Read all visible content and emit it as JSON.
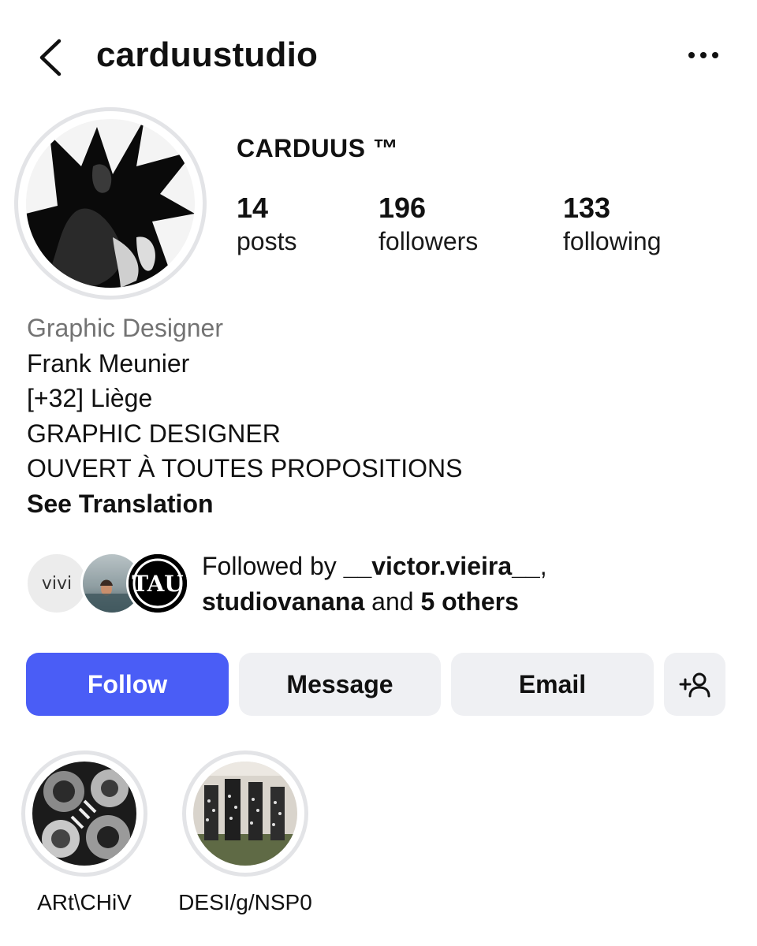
{
  "header": {
    "username": "carduustudio",
    "back_icon": "chevron-left-icon",
    "more_icon": "ellipsis-icon"
  },
  "profile": {
    "display_name": "CARDUUS ™",
    "stats": [
      {
        "value": "14",
        "label": "posts"
      },
      {
        "value": "196",
        "label": "followers"
      },
      {
        "value": "133",
        "label": "following"
      }
    ]
  },
  "bio": {
    "category": "Graphic Designer",
    "lines": [
      "Frank Meunier",
      "[+32] Liège",
      "GRAPHIC DESIGNER",
      "OUVERT À TOUTES PROPOSITIONS"
    ],
    "see_translation": "See Translation"
  },
  "followed_by": {
    "prefix": "Followed by ",
    "user1": "__victor.vieira__",
    "comma": ",",
    "user2": "studiovanana",
    "conjunction": " and ",
    "others": "5 others",
    "avatar1_text": "vivi"
  },
  "actions": {
    "follow": "Follow",
    "message": "Message",
    "email": "Email",
    "add_icon": "add-person-icon"
  },
  "highlights": [
    {
      "label": "ARt\\CHiV"
    },
    {
      "label": "DESI/g/NSP0"
    }
  ],
  "colors": {
    "follow_button": "#4a5df6",
    "secondary_button": "#eff0f3",
    "category_text": "#737373",
    "ring": "#e3e4e7"
  }
}
